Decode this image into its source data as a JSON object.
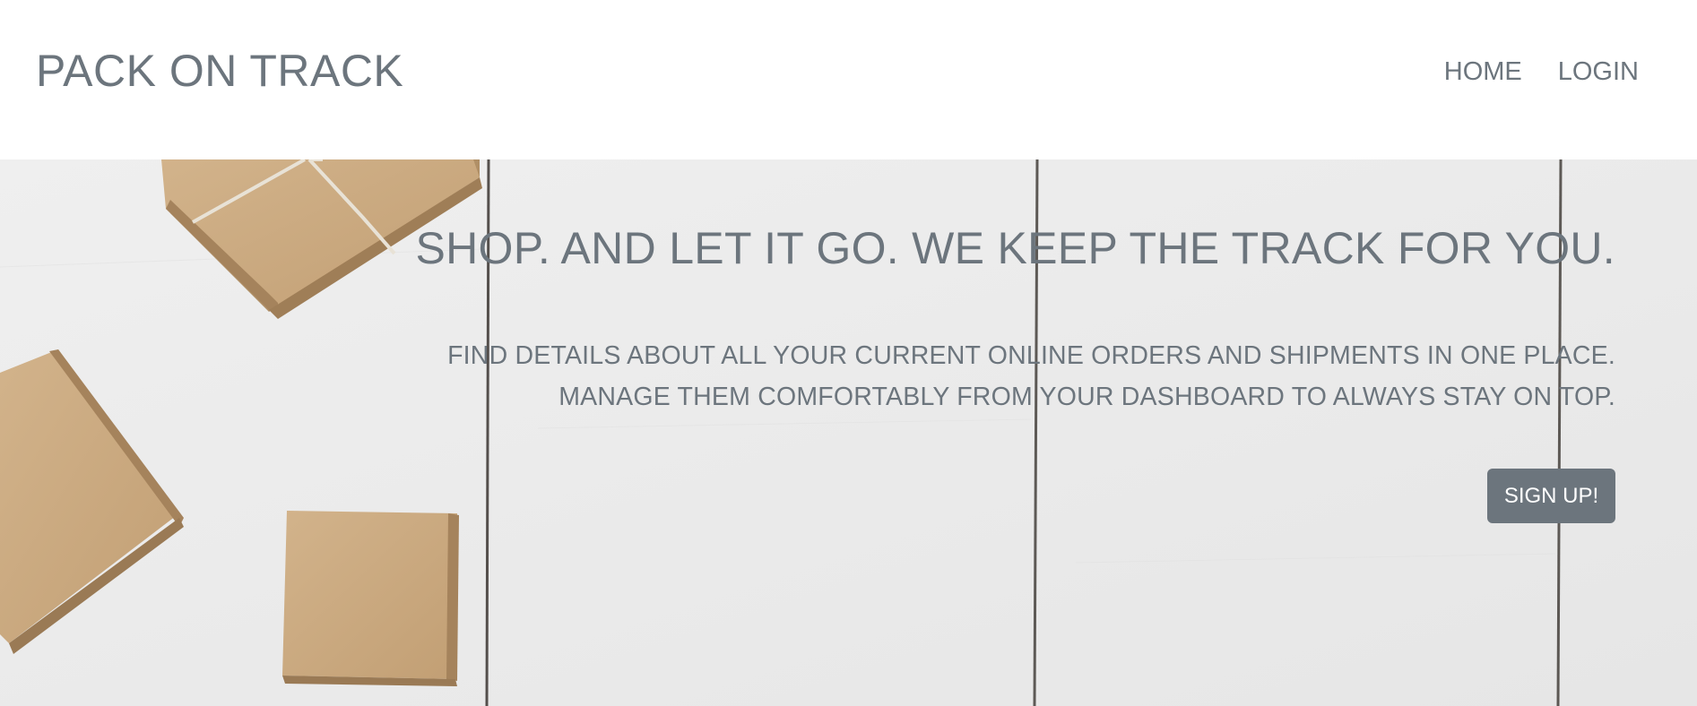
{
  "navbar": {
    "brand": "PACK ON TRACK",
    "links": [
      {
        "label": "HOME"
      },
      {
        "label": "LOGIN"
      }
    ]
  },
  "hero": {
    "title": "SHOP. AND LET IT GO. WE KEEP THE TRACK FOR YOU.",
    "subtitle_line1": "FIND DETAILS ABOUT ALL YOUR CURRENT ONLINE ORDERS AND SHIPMENTS IN ONE PLACE.",
    "subtitle_line2": "MANAGE THEM COMFORTABLY FROM YOUR DASHBOARD TO ALWAYS STAY ON TOP.",
    "cta_label": "SIGN UP!",
    "background_image": "cardboard-boxes-on-white-wooden-planks"
  },
  "colors": {
    "text": "#6c757d",
    "button_bg": "#6c757d",
    "button_text": "#ffffff",
    "navbar_bg": "#ffffff",
    "hero_bg": "#ececec",
    "box": "#c9a87f"
  }
}
